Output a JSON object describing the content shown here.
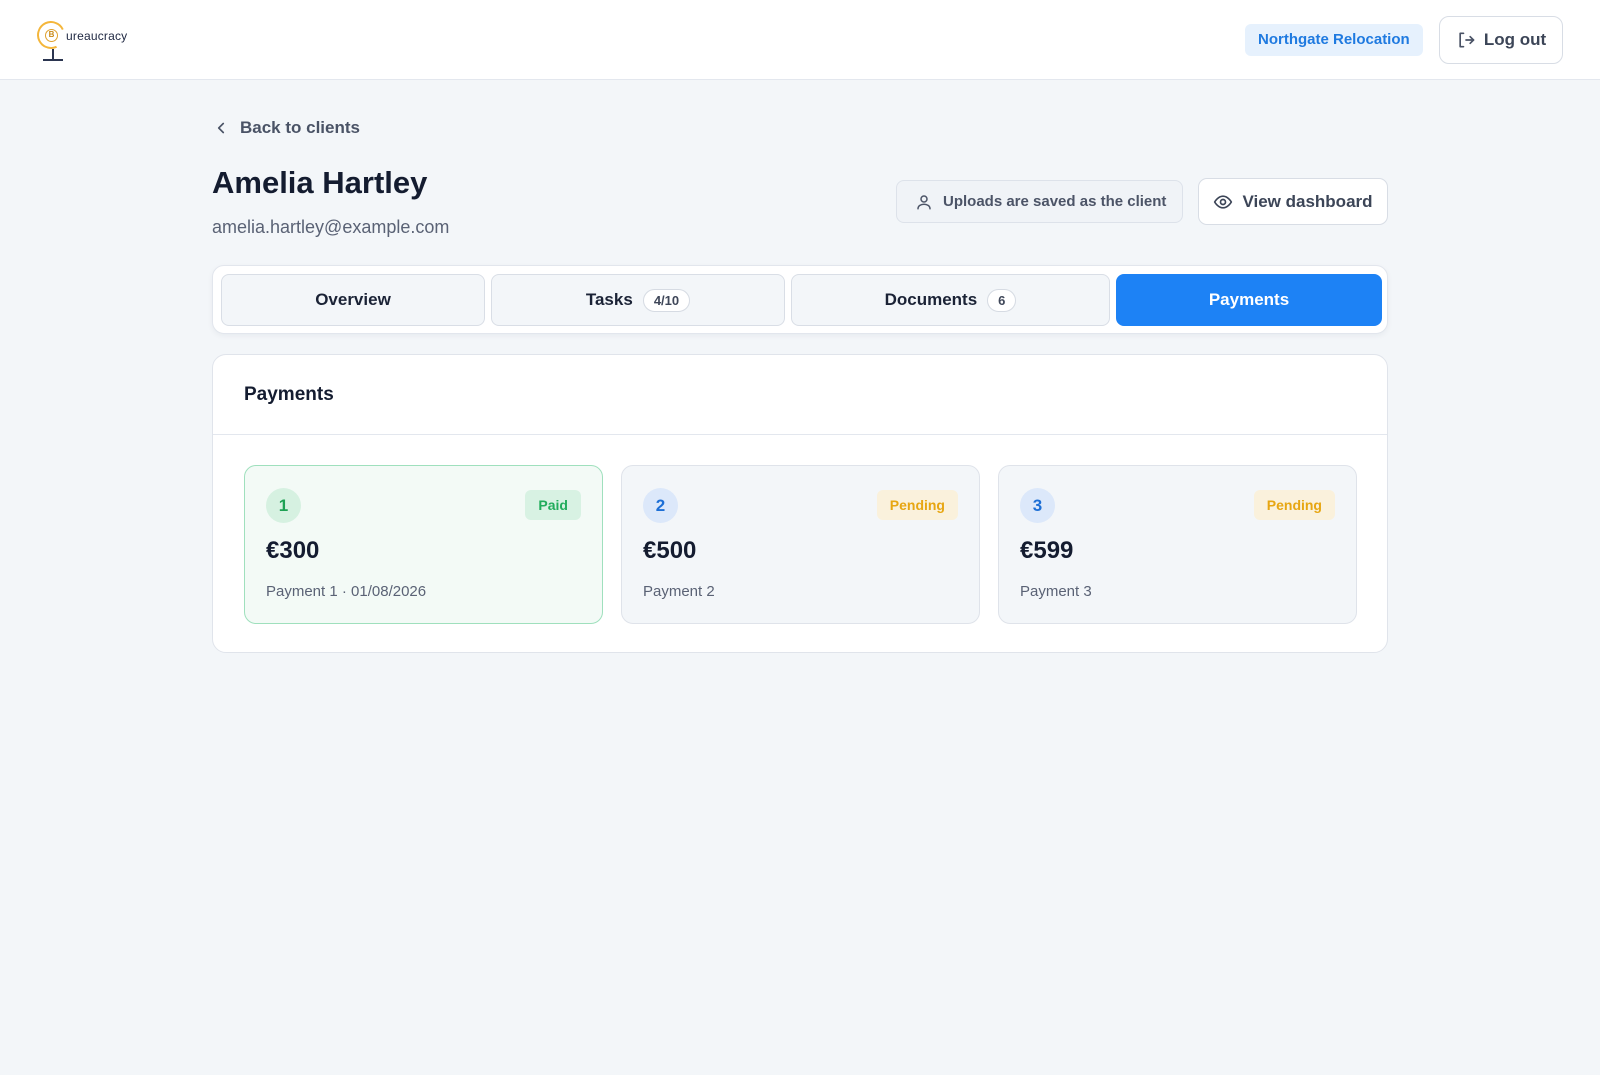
{
  "header": {
    "logo_text": "ureaucracy",
    "logo_letter": "B",
    "org_name": "Northgate Relocation",
    "logout_label": "Log out"
  },
  "back_link": {
    "label": "Back to clients"
  },
  "client": {
    "name": "Amelia Hartley",
    "email": "amelia.hartley@example.com"
  },
  "actions": {
    "uploads_note": "Uploads are saved as the client",
    "view_dashboard_label": "View dashboard"
  },
  "tabs": [
    {
      "label": "Overview",
      "count": null,
      "active": false
    },
    {
      "label": "Tasks",
      "count": "4/10",
      "active": false
    },
    {
      "label": "Documents",
      "count": "6",
      "active": false
    },
    {
      "label": "Payments",
      "count": null,
      "active": true
    }
  ],
  "payments": {
    "title": "Payments",
    "items": [
      {
        "number": "1",
        "status": "Paid",
        "amount": "€300",
        "description": "Payment 1 · 01/08/2026"
      },
      {
        "number": "2",
        "status": "Pending",
        "amount": "€500",
        "description": "Payment 2"
      },
      {
        "number": "3",
        "status": "Pending",
        "amount": "€599",
        "description": "Payment 3"
      }
    ]
  },
  "colors": {
    "accent": "#1d82f5",
    "paid": "#22ad5c",
    "pending": "#e7a612",
    "background": "#f3f6f9"
  },
  "icons": {
    "logo": "bureaucracy-globe-logo",
    "logout": "logout-icon",
    "back": "chevron-left-icon",
    "uploads": "user-icon",
    "view": "eye-icon"
  }
}
